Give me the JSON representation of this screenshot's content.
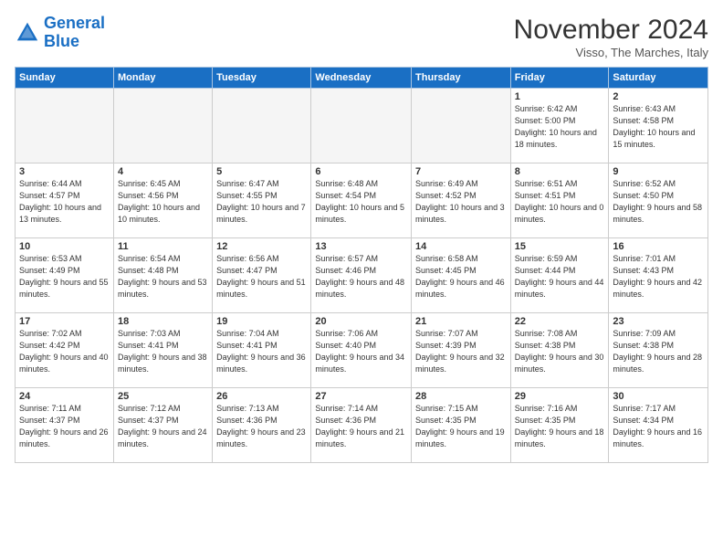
{
  "logo": {
    "line1": "General",
    "line2": "Blue"
  },
  "title": "November 2024",
  "subtitle": "Visso, The Marches, Italy",
  "days_of_week": [
    "Sunday",
    "Monday",
    "Tuesday",
    "Wednesday",
    "Thursday",
    "Friday",
    "Saturday"
  ],
  "weeks": [
    [
      {
        "day": "",
        "info": ""
      },
      {
        "day": "",
        "info": ""
      },
      {
        "day": "",
        "info": ""
      },
      {
        "day": "",
        "info": ""
      },
      {
        "day": "",
        "info": ""
      },
      {
        "day": "1",
        "info": "Sunrise: 6:42 AM\nSunset: 5:00 PM\nDaylight: 10 hours and 18 minutes."
      },
      {
        "day": "2",
        "info": "Sunrise: 6:43 AM\nSunset: 4:58 PM\nDaylight: 10 hours and 15 minutes."
      }
    ],
    [
      {
        "day": "3",
        "info": "Sunrise: 6:44 AM\nSunset: 4:57 PM\nDaylight: 10 hours and 13 minutes."
      },
      {
        "day": "4",
        "info": "Sunrise: 6:45 AM\nSunset: 4:56 PM\nDaylight: 10 hours and 10 minutes."
      },
      {
        "day": "5",
        "info": "Sunrise: 6:47 AM\nSunset: 4:55 PM\nDaylight: 10 hours and 7 minutes."
      },
      {
        "day": "6",
        "info": "Sunrise: 6:48 AM\nSunset: 4:54 PM\nDaylight: 10 hours and 5 minutes."
      },
      {
        "day": "7",
        "info": "Sunrise: 6:49 AM\nSunset: 4:52 PM\nDaylight: 10 hours and 3 minutes."
      },
      {
        "day": "8",
        "info": "Sunrise: 6:51 AM\nSunset: 4:51 PM\nDaylight: 10 hours and 0 minutes."
      },
      {
        "day": "9",
        "info": "Sunrise: 6:52 AM\nSunset: 4:50 PM\nDaylight: 9 hours and 58 minutes."
      }
    ],
    [
      {
        "day": "10",
        "info": "Sunrise: 6:53 AM\nSunset: 4:49 PM\nDaylight: 9 hours and 55 minutes."
      },
      {
        "day": "11",
        "info": "Sunrise: 6:54 AM\nSunset: 4:48 PM\nDaylight: 9 hours and 53 minutes."
      },
      {
        "day": "12",
        "info": "Sunrise: 6:56 AM\nSunset: 4:47 PM\nDaylight: 9 hours and 51 minutes."
      },
      {
        "day": "13",
        "info": "Sunrise: 6:57 AM\nSunset: 4:46 PM\nDaylight: 9 hours and 48 minutes."
      },
      {
        "day": "14",
        "info": "Sunrise: 6:58 AM\nSunset: 4:45 PM\nDaylight: 9 hours and 46 minutes."
      },
      {
        "day": "15",
        "info": "Sunrise: 6:59 AM\nSunset: 4:44 PM\nDaylight: 9 hours and 44 minutes."
      },
      {
        "day": "16",
        "info": "Sunrise: 7:01 AM\nSunset: 4:43 PM\nDaylight: 9 hours and 42 minutes."
      }
    ],
    [
      {
        "day": "17",
        "info": "Sunrise: 7:02 AM\nSunset: 4:42 PM\nDaylight: 9 hours and 40 minutes."
      },
      {
        "day": "18",
        "info": "Sunrise: 7:03 AM\nSunset: 4:41 PM\nDaylight: 9 hours and 38 minutes."
      },
      {
        "day": "19",
        "info": "Sunrise: 7:04 AM\nSunset: 4:41 PM\nDaylight: 9 hours and 36 minutes."
      },
      {
        "day": "20",
        "info": "Sunrise: 7:06 AM\nSunset: 4:40 PM\nDaylight: 9 hours and 34 minutes."
      },
      {
        "day": "21",
        "info": "Sunrise: 7:07 AM\nSunset: 4:39 PM\nDaylight: 9 hours and 32 minutes."
      },
      {
        "day": "22",
        "info": "Sunrise: 7:08 AM\nSunset: 4:38 PM\nDaylight: 9 hours and 30 minutes."
      },
      {
        "day": "23",
        "info": "Sunrise: 7:09 AM\nSunset: 4:38 PM\nDaylight: 9 hours and 28 minutes."
      }
    ],
    [
      {
        "day": "24",
        "info": "Sunrise: 7:11 AM\nSunset: 4:37 PM\nDaylight: 9 hours and 26 minutes."
      },
      {
        "day": "25",
        "info": "Sunrise: 7:12 AM\nSunset: 4:37 PM\nDaylight: 9 hours and 24 minutes."
      },
      {
        "day": "26",
        "info": "Sunrise: 7:13 AM\nSunset: 4:36 PM\nDaylight: 9 hours and 23 minutes."
      },
      {
        "day": "27",
        "info": "Sunrise: 7:14 AM\nSunset: 4:36 PM\nDaylight: 9 hours and 21 minutes."
      },
      {
        "day": "28",
        "info": "Sunrise: 7:15 AM\nSunset: 4:35 PM\nDaylight: 9 hours and 19 minutes."
      },
      {
        "day": "29",
        "info": "Sunrise: 7:16 AM\nSunset: 4:35 PM\nDaylight: 9 hours and 18 minutes."
      },
      {
        "day": "30",
        "info": "Sunrise: 7:17 AM\nSunset: 4:34 PM\nDaylight: 9 hours and 16 minutes."
      }
    ]
  ]
}
